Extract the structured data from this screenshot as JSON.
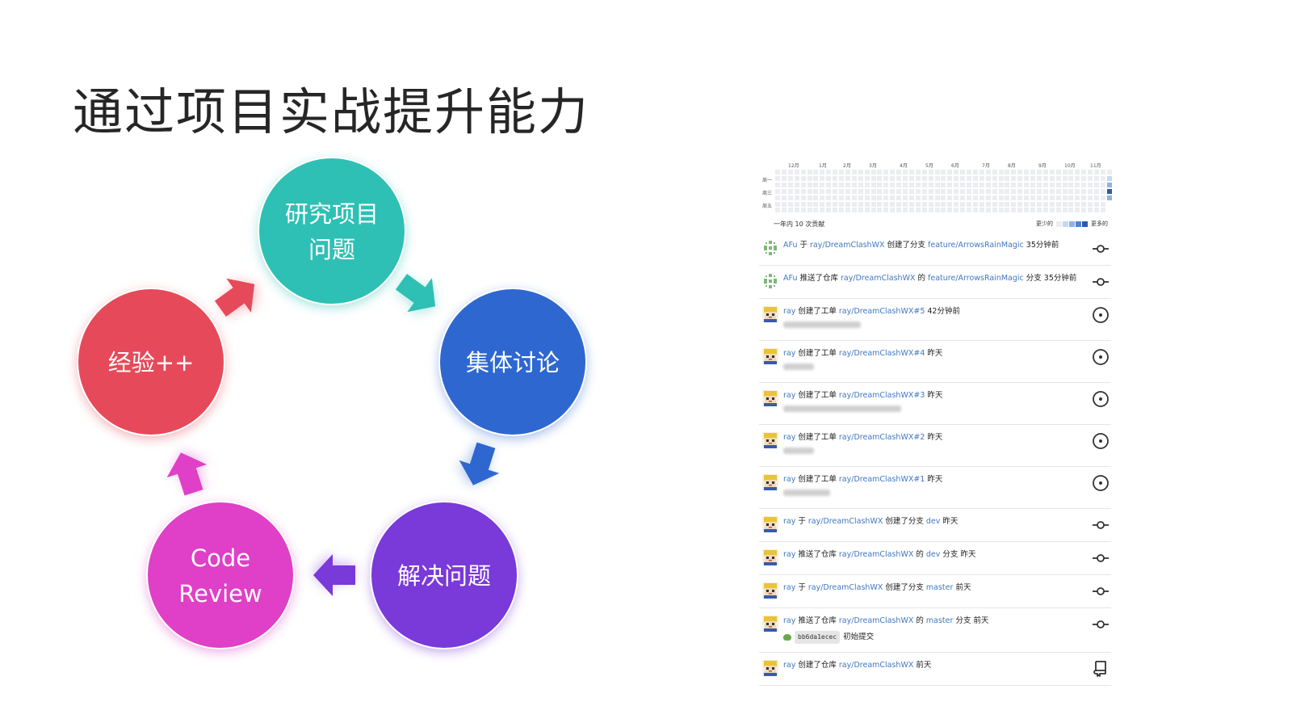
{
  "slide": {
    "title": "通过项目实战提升能力"
  },
  "cycle": {
    "nodes": [
      {
        "id": "research",
        "lines": [
          "研究项目",
          "问题"
        ],
        "color": "#2ec0b4"
      },
      {
        "id": "discuss",
        "lines": [
          "集体讨论"
        ],
        "color": "#2e67d0"
      },
      {
        "id": "solve",
        "lines": [
          "解决问题"
        ],
        "color": "#7a39d9"
      },
      {
        "id": "review",
        "lines": [
          "Code",
          "Review"
        ],
        "color": "#e03fc7"
      },
      {
        "id": "exp",
        "lines": [
          "经验++"
        ],
        "color": "#e64a5a"
      }
    ]
  },
  "activity": {
    "months": [
      "12月",
      "1月",
      "2月",
      "3月",
      "4月",
      "5月",
      "6月",
      "7月",
      "8月",
      "9月",
      "10月",
      "11月"
    ],
    "days": [
      "周一",
      "周三",
      "周五"
    ],
    "contrib_text": "一年内 10 次贡献",
    "legend_less": "更少的",
    "legend_more": "更多的",
    "legend_colors": [
      "#ebedf0",
      "#c6d8f0",
      "#8fb2e0",
      "#4f86cc",
      "#2a5ca8"
    ],
    "feed": [
      {
        "avatar": "afu",
        "icon": "commit",
        "parts": [
          [
            "lk",
            "AFu"
          ],
          [
            "t",
            " 于 "
          ],
          [
            "lk",
            "ray/DreamClashWX"
          ],
          [
            "t",
            " 创建了分支 "
          ],
          [
            "lk",
            "feature/ArrowsRainMagic"
          ],
          [
            "t",
            " 35分钟前"
          ]
        ]
      },
      {
        "avatar": "afu",
        "icon": "commit",
        "parts": [
          [
            "lk",
            "AFu"
          ],
          [
            "t",
            " 推送了仓库 "
          ],
          [
            "lk",
            "ray/DreamClashWX"
          ],
          [
            "t",
            " 的 "
          ],
          [
            "lk",
            "feature/ArrowsRainMagic"
          ],
          [
            "t",
            " 分支 35分钟前"
          ]
        ]
      },
      {
        "avatar": "ray",
        "icon": "issue",
        "blur": 96,
        "parts": [
          [
            "lk",
            "ray"
          ],
          [
            "t",
            " 创建了工单 "
          ],
          [
            "lk",
            "ray/DreamClashWX#5"
          ],
          [
            "t",
            " 42分钟前"
          ]
        ]
      },
      {
        "avatar": "ray",
        "icon": "issue",
        "blur": 38,
        "parts": [
          [
            "lk",
            "ray"
          ],
          [
            "t",
            " 创建了工单 "
          ],
          [
            "lk",
            "ray/DreamClashWX#4"
          ],
          [
            "t",
            " 昨天"
          ]
        ]
      },
      {
        "avatar": "ray",
        "icon": "issue",
        "blur": 146,
        "parts": [
          [
            "lk",
            "ray"
          ],
          [
            "t",
            " 创建了工单 "
          ],
          [
            "lk",
            "ray/DreamClashWX#3"
          ],
          [
            "t",
            " 昨天"
          ]
        ]
      },
      {
        "avatar": "ray",
        "icon": "issue",
        "blur": 38,
        "parts": [
          [
            "lk",
            "ray"
          ],
          [
            "t",
            " 创建了工单 "
          ],
          [
            "lk",
            "ray/DreamClashWX#2"
          ],
          [
            "t",
            " 昨天"
          ]
        ]
      },
      {
        "avatar": "ray",
        "icon": "issue",
        "blur": 58,
        "parts": [
          [
            "lk",
            "ray"
          ],
          [
            "t",
            " 创建了工单 "
          ],
          [
            "lk",
            "ray/DreamClashWX#1"
          ],
          [
            "t",
            " 昨天"
          ]
        ]
      },
      {
        "avatar": "ray",
        "icon": "commit",
        "parts": [
          [
            "lk",
            "ray"
          ],
          [
            "t",
            " 于 "
          ],
          [
            "lk",
            "ray/DreamClashWX"
          ],
          [
            "t",
            " 创建了分支 "
          ],
          [
            "lk",
            "dev"
          ],
          [
            "t",
            " 昨天"
          ]
        ]
      },
      {
        "avatar": "ray",
        "icon": "commit",
        "parts": [
          [
            "lk",
            "ray"
          ],
          [
            "t",
            " 推送了仓库 "
          ],
          [
            "lk",
            "ray/DreamClashWX"
          ],
          [
            "t",
            " 的 "
          ],
          [
            "lk",
            "dev"
          ],
          [
            "t",
            " 分支 昨天"
          ]
        ]
      },
      {
        "avatar": "ray",
        "icon": "commit",
        "parts": [
          [
            "lk",
            "ray"
          ],
          [
            "t",
            " 于 "
          ],
          [
            "lk",
            "ray/DreamClashWX"
          ],
          [
            "t",
            " 创建了分支 "
          ],
          [
            "lk",
            "master"
          ],
          [
            "t",
            " 前天"
          ]
        ]
      },
      {
        "avatar": "ray",
        "icon": "commit",
        "commit": {
          "sha": "bb6da1ecec",
          "msg": "初始提交"
        },
        "parts": [
          [
            "lk",
            "ray"
          ],
          [
            "t",
            " 推送了仓库 "
          ],
          [
            "lk",
            "ray/DreamClashWX"
          ],
          [
            "t",
            " 的 "
          ],
          [
            "lk",
            "master"
          ],
          [
            "t",
            " 分支 前天"
          ]
        ]
      },
      {
        "avatar": "ray",
        "icon": "repo",
        "parts": [
          [
            "lk",
            "ray"
          ],
          [
            "t",
            " 创建了仓库 "
          ],
          [
            "lk",
            "ray/DreamClashWX"
          ],
          [
            "t",
            " 前天"
          ]
        ]
      }
    ]
  }
}
